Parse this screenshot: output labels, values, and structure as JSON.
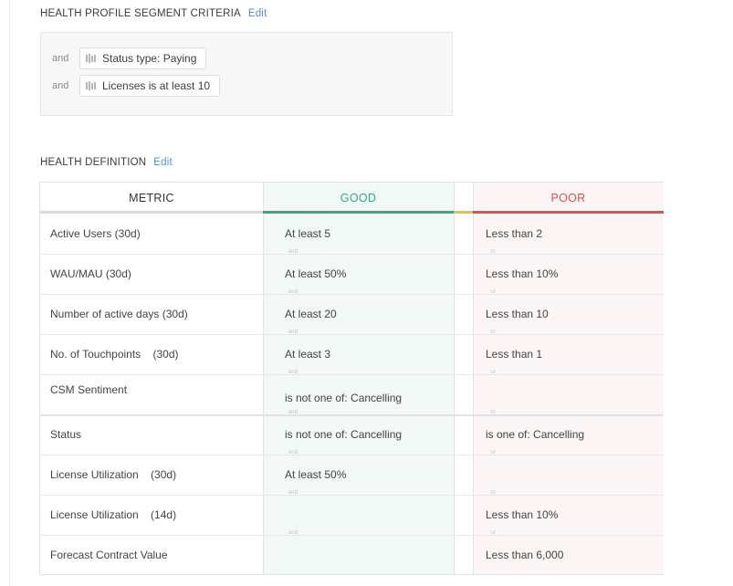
{
  "segment_criteria": {
    "title": "HEALTH PROFILE SEGMENT CRITERIA",
    "edit_label": "Edit",
    "rows": [
      {
        "joiner": "and",
        "label": "Status type: Paying"
      },
      {
        "joiner": "and",
        "label": "Licenses is at least 10"
      }
    ]
  },
  "health_definition": {
    "title": "HEALTH DEFINITION",
    "edit_label": "Edit",
    "headers": {
      "metric": "METRIC",
      "good": "GOOD",
      "poor": "POOR"
    },
    "colors": {
      "good": "#3aa57d",
      "poor": "#d9534f",
      "neutral": "#e8c14a"
    },
    "rows": [
      {
        "metric": "Active Users (30d)",
        "good": "At least 5",
        "poor": "Less than 2"
      },
      {
        "metric": "WAU/MAU (30d)",
        "good": "At least 50%",
        "poor": "Less than 10%"
      },
      {
        "metric": "Number of active days (30d)",
        "good": "At least 20",
        "poor": "Less than 10"
      },
      {
        "metric": "No. of Touchpoints    (30d)",
        "good": "At least 3",
        "poor": "Less than 1"
      },
      {
        "metric": "CSM Sentiment",
        "good": "is not one of: Cancelling",
        "poor": ""
      },
      {
        "metric": "Status",
        "good": "is not one of: Cancelling",
        "poor": "is one of: Cancelling"
      },
      {
        "metric": "License Utilization    (30d)",
        "good": "At least 50%",
        "poor": ""
      },
      {
        "metric": "License Utilization    (14d)",
        "good": "",
        "poor": "Less than 10%"
      },
      {
        "metric": "Forecast Contract Value",
        "good": "",
        "poor": "Less than 6,000"
      }
    ],
    "connectors": {
      "good": "and",
      "poor": "or"
    }
  }
}
